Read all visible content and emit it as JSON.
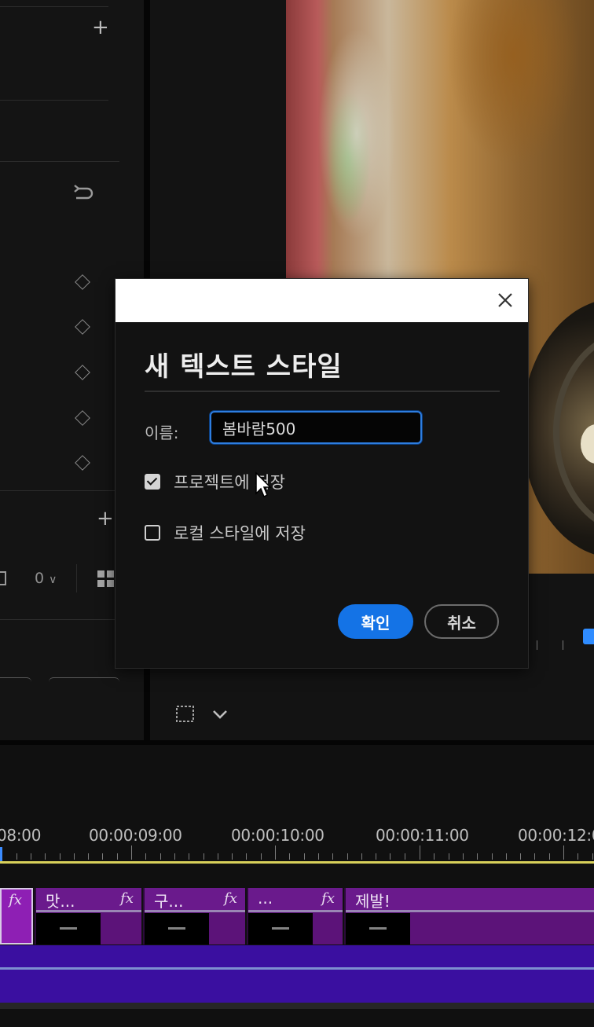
{
  "dialog": {
    "title": "새 텍스트 스타일",
    "name_label": "이름:",
    "name_value": "봄바람500",
    "save_to_project_label": "프로젝트에 저장",
    "save_to_project_checked": true,
    "save_to_local_label": "로컬 스타일에 저장",
    "save_to_local_checked": false,
    "ok_label": "확인",
    "cancel_label": "취소"
  },
  "left_panel": {
    "dropdown_value": "0",
    "icons": [
      "plus-icon",
      "reset-icon",
      "keyframe-diamond-icon",
      "grid-icon"
    ]
  },
  "timeline": {
    "timecodes": [
      "08:00",
      "00:00:09:00",
      "00:00:10:00",
      "00:00:11:00",
      "00:00:12:0"
    ],
    "clips": [
      {
        "name": "",
        "fx": "fx"
      },
      {
        "name": "맛...",
        "fx": "fx"
      },
      {
        "name": "구...",
        "fx": "fx"
      },
      {
        "name": "...",
        "fx": "fx"
      },
      {
        "name": "제발!",
        "fx": ""
      }
    ]
  },
  "colors": {
    "accent_blue": "#1473e6",
    "clip_purple": "#6a1a8c",
    "audio_track": "#3a0fa0",
    "work_area": "#d8d05a"
  }
}
